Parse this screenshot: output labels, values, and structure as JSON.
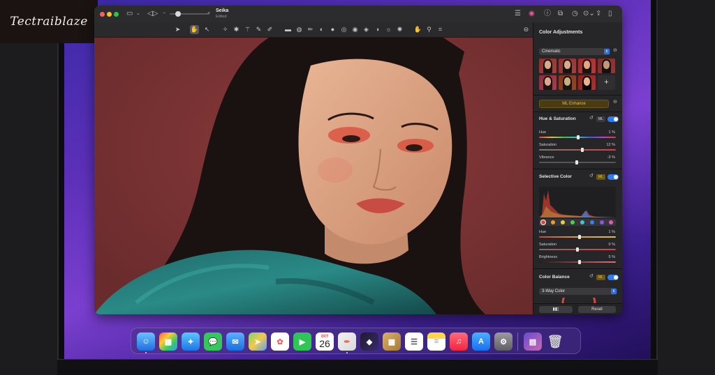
{
  "branding": {
    "watermark": "Tectraiblaze"
  },
  "window": {
    "doc_title": "Seika",
    "doc_subtitle": "Edited",
    "traffic_lights": [
      "#ff5f57",
      "#febc2e",
      "#28c840"
    ]
  },
  "panel": {
    "title": "Color Adjustments",
    "preset": "Cinematic",
    "ml_enhance": "ML Enhance",
    "hue_saturation": {
      "title": "Hue & Saturation",
      "ml": "ML",
      "enabled": true,
      "hue": {
        "label": "Hue",
        "value": "1 %"
      },
      "saturation": {
        "label": "Saturation",
        "value": "12 %"
      },
      "vibrance": {
        "label": "Vibrance",
        "value": "-3 %"
      }
    },
    "selective_color": {
      "title": "Selective Color",
      "ml": "ML",
      "enabled": true,
      "hue": {
        "label": "Hue",
        "value": "1 %"
      },
      "saturation": {
        "label": "Saturation",
        "value": "0 %"
      },
      "brightness": {
        "label": "Brightness",
        "value": "5 %"
      },
      "swatch_colors": [
        "#e0453a",
        "#f09a2a",
        "#e8d23a",
        "#4fcf52",
        "#3fc6c9",
        "#3d7cf2",
        "#8e55e8",
        "#e05ab8"
      ]
    },
    "color_balance": {
      "title": "Color Balance",
      "ml": "ML",
      "enabled": true,
      "mode": "3-Way Color"
    },
    "footer": {
      "reset": "Reset"
    }
  },
  "accent_color": "#2f7bf0"
}
